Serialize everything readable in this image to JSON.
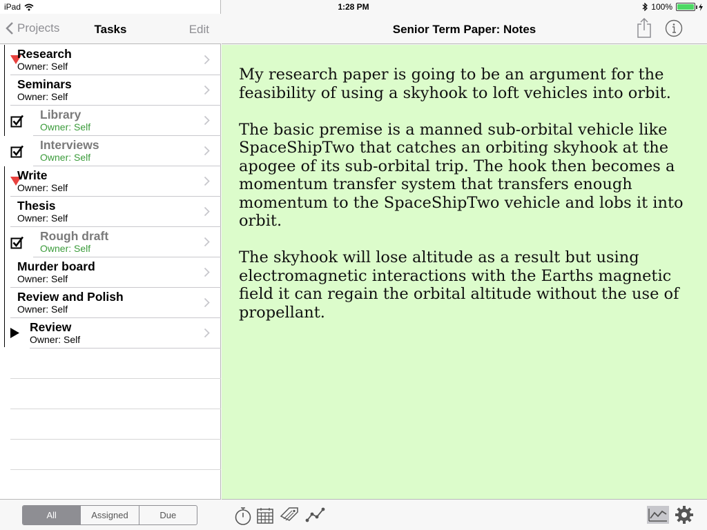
{
  "status_bar": {
    "device": "iPad",
    "time": "1:28 PM",
    "battery": "100%"
  },
  "left_nav": {
    "back_label": "Projects",
    "title": "Tasks",
    "edit_label": "Edit"
  },
  "tasks": [
    {
      "title": "Research",
      "owner": "Owner: Self",
      "marker": "expanded-triangle",
      "done": false,
      "indent": 1
    },
    {
      "title": "Seminars",
      "owner": "Owner: Self",
      "marker": "none",
      "done": false,
      "indent": 1
    },
    {
      "title": "Library",
      "owner": "Owner: Self",
      "marker": "checkbox-checked",
      "done": true,
      "indent": 2
    },
    {
      "title": "Interviews",
      "owner": "Owner: Self",
      "marker": "checkbox-checked",
      "done": true,
      "indent": 2
    },
    {
      "title": "Write",
      "owner": "Owner: Self",
      "marker": "expanded-triangle",
      "done": false,
      "indent": 1
    },
    {
      "title": "Thesis",
      "owner": "Owner: Self",
      "marker": "none",
      "done": false,
      "indent": 1
    },
    {
      "title": "Rough draft",
      "owner": "Owner: Self",
      "marker": "checkbox-checked",
      "done": true,
      "indent": 2
    },
    {
      "title": "Murder board",
      "owner": "Owner: Self",
      "marker": "none",
      "done": false,
      "indent": 1
    },
    {
      "title": "Review and Polish",
      "owner": "Owner: Self",
      "marker": "none",
      "done": false,
      "indent": 1
    },
    {
      "title": "Review",
      "owner": "Owner: Self",
      "marker": "collapsed-triangle",
      "done": false,
      "indent": 1
    }
  ],
  "filter": {
    "options": [
      "All",
      "Assigned",
      "Due"
    ],
    "selected": "All"
  },
  "detail": {
    "title": "Senior Term Paper: Notes",
    "paragraphs": [
      "My research paper is going to be an argument for the feasibility of using a skyhook to loft vehicles into orbit.",
      "The basic premise is a manned sub-orbital vehicle like SpaceShipTwo that catches an orbiting skyhook at the apogee of its sub-orbital trip. The hook then becomes a momentum transfer system that transfers enough momentum to the SpaceShipTwo vehicle and lobs it into orbit.",
      "The skyhook will lose altitude as a result but using electromagnetic interactions with the Earths magnetic field it can regain the orbital altitude without the use of propellant."
    ]
  },
  "colors": {
    "note_background": "#dcfccb",
    "triangle_red": "#e8423f",
    "done_green": "#3a9b3a",
    "chrome_gray": "#8e8e93"
  },
  "toolbar_icons": [
    "stopwatch-icon",
    "calendar-icon",
    "tag-icon",
    "graph-icon",
    "chart-toggle-icon",
    "gear-icon"
  ]
}
